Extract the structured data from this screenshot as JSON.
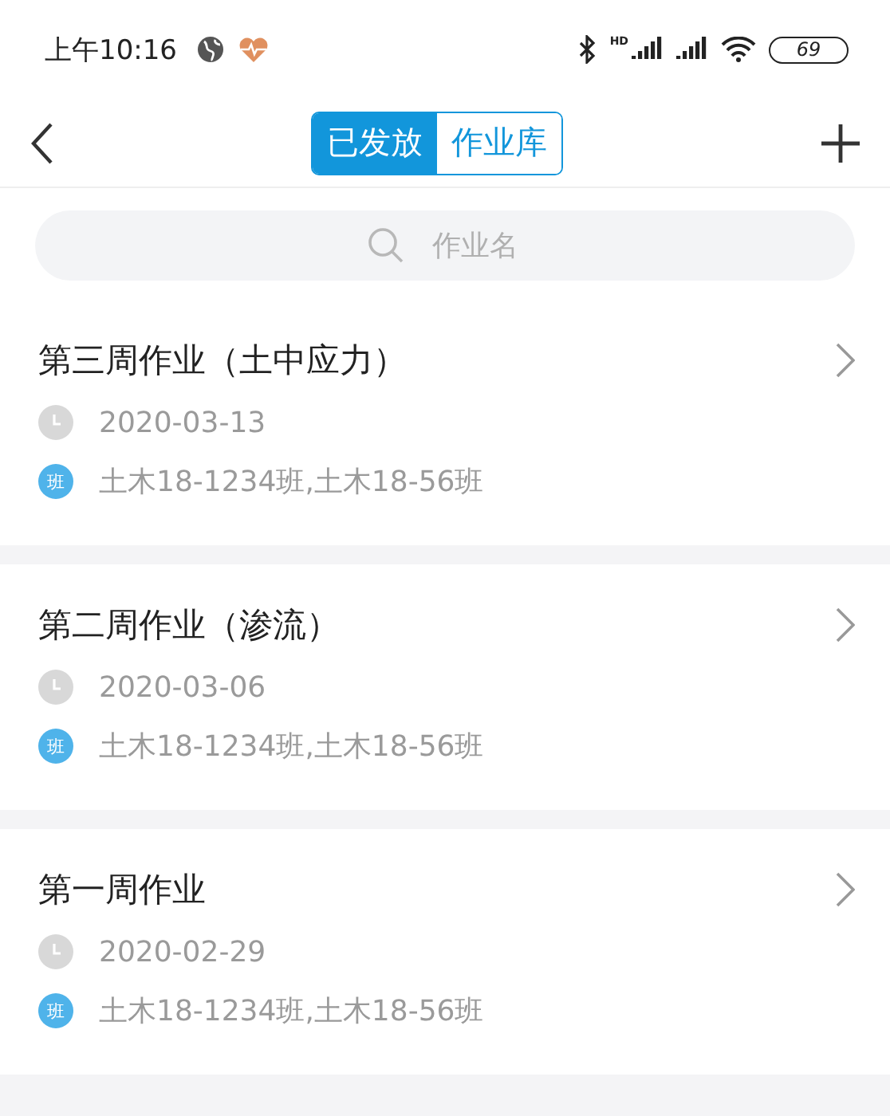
{
  "status_bar": {
    "time": "上午10:16",
    "network_label": "HD",
    "battery": "69"
  },
  "nav": {
    "tabs": [
      {
        "label": "已发放",
        "selected": true
      },
      {
        "label": "作业库",
        "selected": false
      }
    ]
  },
  "search": {
    "placeholder": "作业名"
  },
  "assignments": [
    {
      "title": "第三周作业（土中应力）",
      "date": "2020-03-13",
      "badge": "班",
      "classes": "土木18-1234班,土木18-56班"
    },
    {
      "title": "第二周作业（渗流）",
      "date": "2020-03-06",
      "badge": "班",
      "classes": "土木18-1234班,土木18-56班"
    },
    {
      "title": "第一周作业",
      "date": "2020-02-29",
      "badge": "班",
      "classes": "土木18-1234班,土木18-56班"
    }
  ]
}
